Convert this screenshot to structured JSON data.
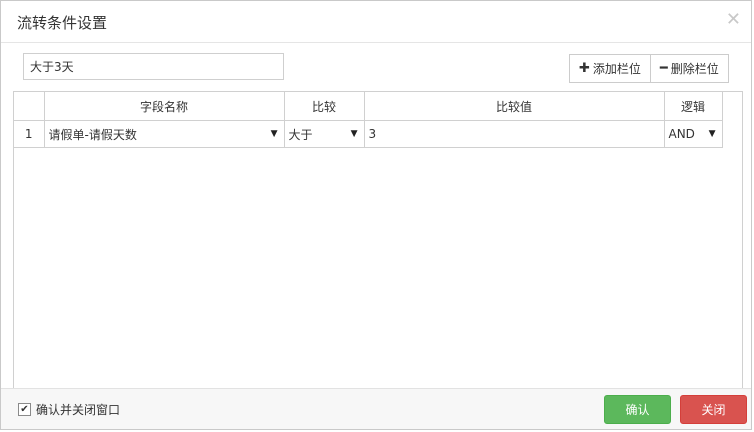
{
  "dialog": {
    "title": "流转条件设置",
    "close_icon": "close-icon"
  },
  "toolbar": {
    "name_value": "大于3天",
    "add_column_label": "添加栏位",
    "add_icon": "plus-icon",
    "delete_column_label": "删除栏位",
    "delete_icon": "minus-icon"
  },
  "grid": {
    "columns": [
      "",
      "字段名称",
      "比较",
      "比较值",
      "逻辑"
    ],
    "rows": [
      {
        "index": "1",
        "field": "请假单-请假天数",
        "compare": "大于",
        "value": "3",
        "logic": "AND"
      }
    ]
  },
  "footer": {
    "confirm_close_label": "确认并关闭窗口",
    "confirm_close_checked": true,
    "ok_label": "确认",
    "close_label": "关闭"
  },
  "colors": {
    "ok_green": "#5cb85c",
    "close_red": "#d9534f"
  }
}
